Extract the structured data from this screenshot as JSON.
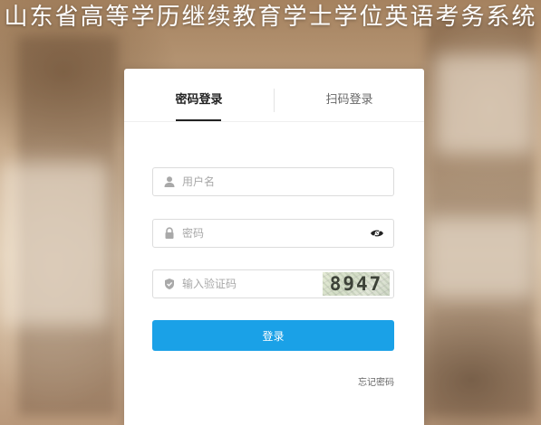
{
  "site": {
    "title": "山东省高等学历继续教育学士学位英语考务系统"
  },
  "tabs": [
    {
      "label": "密码登录",
      "active": true
    },
    {
      "label": "扫码登录",
      "active": false
    }
  ],
  "form": {
    "username": {
      "placeholder": "用户名",
      "value": "",
      "icon": "user-icon"
    },
    "password": {
      "placeholder": "密码",
      "value": "",
      "icon": "lock-icon",
      "toggle_icon": "eye-icon"
    },
    "captcha": {
      "placeholder": "输入验证码",
      "value": "",
      "icon": "shield-icon",
      "image_text": "8947"
    },
    "submit_label": "登录",
    "forgot_label": "忘记密码"
  },
  "colors": {
    "primary": "#1aa1e7",
    "background": "#b69a7c"
  }
}
